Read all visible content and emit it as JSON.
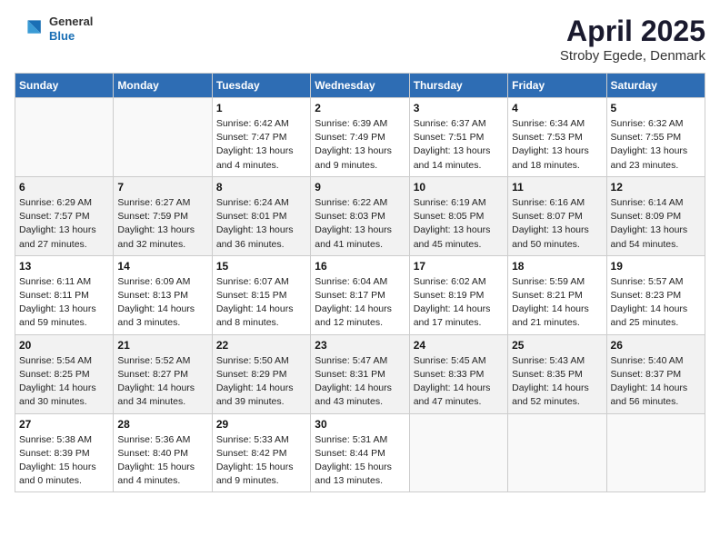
{
  "header": {
    "logo": {
      "general": "General",
      "blue": "Blue"
    },
    "title": "April 2025",
    "subtitle": "Stroby Egede, Denmark"
  },
  "weekdays": [
    "Sunday",
    "Monday",
    "Tuesday",
    "Wednesday",
    "Thursday",
    "Friday",
    "Saturday"
  ],
  "weeks": [
    [
      {
        "day": "",
        "info": ""
      },
      {
        "day": "",
        "info": ""
      },
      {
        "day": "1",
        "info": "Sunrise: 6:42 AM\nSunset: 7:47 PM\nDaylight: 13 hours\nand 4 minutes."
      },
      {
        "day": "2",
        "info": "Sunrise: 6:39 AM\nSunset: 7:49 PM\nDaylight: 13 hours\nand 9 minutes."
      },
      {
        "day": "3",
        "info": "Sunrise: 6:37 AM\nSunset: 7:51 PM\nDaylight: 13 hours\nand 14 minutes."
      },
      {
        "day": "4",
        "info": "Sunrise: 6:34 AM\nSunset: 7:53 PM\nDaylight: 13 hours\nand 18 minutes."
      },
      {
        "day": "5",
        "info": "Sunrise: 6:32 AM\nSunset: 7:55 PM\nDaylight: 13 hours\nand 23 minutes."
      }
    ],
    [
      {
        "day": "6",
        "info": "Sunrise: 6:29 AM\nSunset: 7:57 PM\nDaylight: 13 hours\nand 27 minutes."
      },
      {
        "day": "7",
        "info": "Sunrise: 6:27 AM\nSunset: 7:59 PM\nDaylight: 13 hours\nand 32 minutes."
      },
      {
        "day": "8",
        "info": "Sunrise: 6:24 AM\nSunset: 8:01 PM\nDaylight: 13 hours\nand 36 minutes."
      },
      {
        "day": "9",
        "info": "Sunrise: 6:22 AM\nSunset: 8:03 PM\nDaylight: 13 hours\nand 41 minutes."
      },
      {
        "day": "10",
        "info": "Sunrise: 6:19 AM\nSunset: 8:05 PM\nDaylight: 13 hours\nand 45 minutes."
      },
      {
        "day": "11",
        "info": "Sunrise: 6:16 AM\nSunset: 8:07 PM\nDaylight: 13 hours\nand 50 minutes."
      },
      {
        "day": "12",
        "info": "Sunrise: 6:14 AM\nSunset: 8:09 PM\nDaylight: 13 hours\nand 54 minutes."
      }
    ],
    [
      {
        "day": "13",
        "info": "Sunrise: 6:11 AM\nSunset: 8:11 PM\nDaylight: 13 hours\nand 59 minutes."
      },
      {
        "day": "14",
        "info": "Sunrise: 6:09 AM\nSunset: 8:13 PM\nDaylight: 14 hours\nand 3 minutes."
      },
      {
        "day": "15",
        "info": "Sunrise: 6:07 AM\nSunset: 8:15 PM\nDaylight: 14 hours\nand 8 minutes."
      },
      {
        "day": "16",
        "info": "Sunrise: 6:04 AM\nSunset: 8:17 PM\nDaylight: 14 hours\nand 12 minutes."
      },
      {
        "day": "17",
        "info": "Sunrise: 6:02 AM\nSunset: 8:19 PM\nDaylight: 14 hours\nand 17 minutes."
      },
      {
        "day": "18",
        "info": "Sunrise: 5:59 AM\nSunset: 8:21 PM\nDaylight: 14 hours\nand 21 minutes."
      },
      {
        "day": "19",
        "info": "Sunrise: 5:57 AM\nSunset: 8:23 PM\nDaylight: 14 hours\nand 25 minutes."
      }
    ],
    [
      {
        "day": "20",
        "info": "Sunrise: 5:54 AM\nSunset: 8:25 PM\nDaylight: 14 hours\nand 30 minutes."
      },
      {
        "day": "21",
        "info": "Sunrise: 5:52 AM\nSunset: 8:27 PM\nDaylight: 14 hours\nand 34 minutes."
      },
      {
        "day": "22",
        "info": "Sunrise: 5:50 AM\nSunset: 8:29 PM\nDaylight: 14 hours\nand 39 minutes."
      },
      {
        "day": "23",
        "info": "Sunrise: 5:47 AM\nSunset: 8:31 PM\nDaylight: 14 hours\nand 43 minutes."
      },
      {
        "day": "24",
        "info": "Sunrise: 5:45 AM\nSunset: 8:33 PM\nDaylight: 14 hours\nand 47 minutes."
      },
      {
        "day": "25",
        "info": "Sunrise: 5:43 AM\nSunset: 8:35 PM\nDaylight: 14 hours\nand 52 minutes."
      },
      {
        "day": "26",
        "info": "Sunrise: 5:40 AM\nSunset: 8:37 PM\nDaylight: 14 hours\nand 56 minutes."
      }
    ],
    [
      {
        "day": "27",
        "info": "Sunrise: 5:38 AM\nSunset: 8:39 PM\nDaylight: 15 hours\nand 0 minutes."
      },
      {
        "day": "28",
        "info": "Sunrise: 5:36 AM\nSunset: 8:40 PM\nDaylight: 15 hours\nand 4 minutes."
      },
      {
        "day": "29",
        "info": "Sunrise: 5:33 AM\nSunset: 8:42 PM\nDaylight: 15 hours\nand 9 minutes."
      },
      {
        "day": "30",
        "info": "Sunrise: 5:31 AM\nSunset: 8:44 PM\nDaylight: 15 hours\nand 13 minutes."
      },
      {
        "day": "",
        "info": ""
      },
      {
        "day": "",
        "info": ""
      },
      {
        "day": "",
        "info": ""
      }
    ]
  ]
}
